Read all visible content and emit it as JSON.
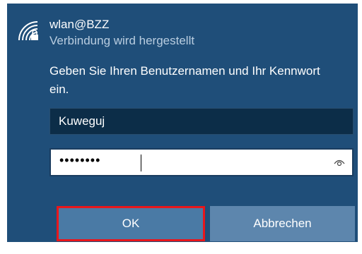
{
  "network": {
    "icon": "wifi-secured-icon",
    "ssid": "wlan@BZZ",
    "status": "Verbindung wird hergestellt"
  },
  "prompt": "Geben Sie Ihren Benutzernamen und Ihr Kennwort ein.",
  "fields": {
    "username_value": "Kuweguj",
    "password_masked": "••••••••",
    "reveal_icon": "eye-icon"
  },
  "buttons": {
    "ok_label": "OK",
    "cancel_label": "Abbrechen"
  },
  "colors": {
    "panel": "#1f4e79",
    "highlight_border": "#e8161b"
  }
}
